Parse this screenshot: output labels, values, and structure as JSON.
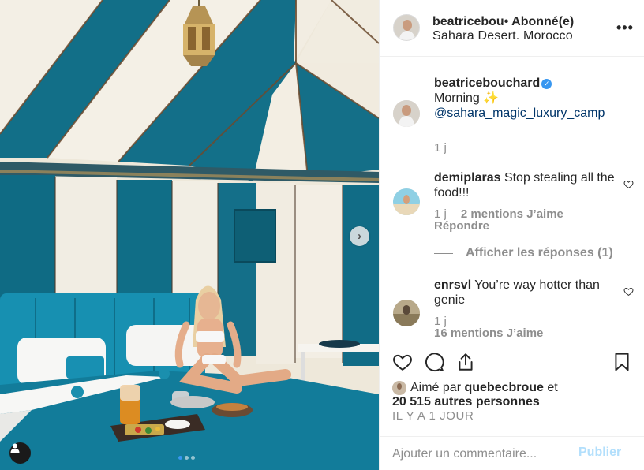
{
  "post": {
    "username": "beatricebou",
    "separator": "•",
    "follow_label": "Abonné(e)",
    "location": "Sahara Desert. Morocco",
    "more_label": "•••"
  },
  "caption": {
    "username": "beatricebouchard",
    "verified_glyph": "✓",
    "text": "Morning ✨",
    "mention": "@sahara_magic_luxury_camp",
    "age": "1 j"
  },
  "comments": [
    {
      "username": "demiplaras",
      "text": "Stop stealing all the food!!!",
      "age": "1 j",
      "likes": "2 mentions J’aime",
      "reply_label": "Répondre",
      "view_replies": "Afficher les réponses (1)"
    },
    {
      "username": "enrsvl",
      "text": "You’re way hotter than genie",
      "age": "1 j",
      "likes": "16 mentions J’aime"
    }
  ],
  "likes": {
    "prefix": "Aimé par",
    "user": "quebecbroue",
    "middle": "et",
    "count": "20 515 autres personnes"
  },
  "timestamp": "IL Y A 1 JOUR",
  "composer": {
    "placeholder": "Ajouter un commentaire...",
    "post_label": "Publier"
  },
  "carousel": {
    "slides": 3,
    "active": 1,
    "next_glyph": "›"
  },
  "colors": {
    "teal": "#0f6d86",
    "canvas": "#f2eee3",
    "link": "#003569",
    "verified": "#3897f0",
    "post_disabled": "#b2dffc",
    "muted": "#8e8e8e"
  }
}
